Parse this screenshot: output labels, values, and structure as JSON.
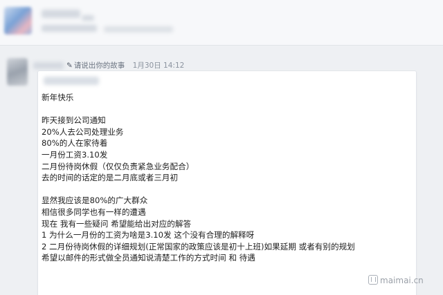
{
  "post": {
    "action_label": "请说出你的故事",
    "date": "1月30日",
    "time": "14:12"
  },
  "message_lines": [
    "新年快乐",
    "",
    "昨天接到公司通知",
    "20%人去公司处理业务",
    "80%的人在家待着",
    "一月份工资3.10发",
    "二月份待岗休假（仅仅负责紧急业务配合）",
    "去的时间的话定的是二月底或者三月初",
    "",
    "显然我应该是80%的广大群众",
    "相信很多同学也有一样的遭遇",
    "现在 我有一些疑问 希望能给出对应的解答",
    "1 为什么一月份的工资为啥是3.10发 这个没有合理的解释呀",
    "2 二月份待岗休假的详细规划(正常国家的政策应该是初十上班)如果延期 或者有别的规划",
    "希望以邮件的形式做全员通知说清楚工作的方式时间 和 待遇"
  ],
  "watermark": {
    "text": "maimai.cn",
    "icon": "maimai-logo-icon"
  },
  "colors": {
    "page_bg": "#eef0f3",
    "bubble_bg": "#ffffff",
    "text": "#1e1e1e",
    "meta": "#6a7380"
  }
}
